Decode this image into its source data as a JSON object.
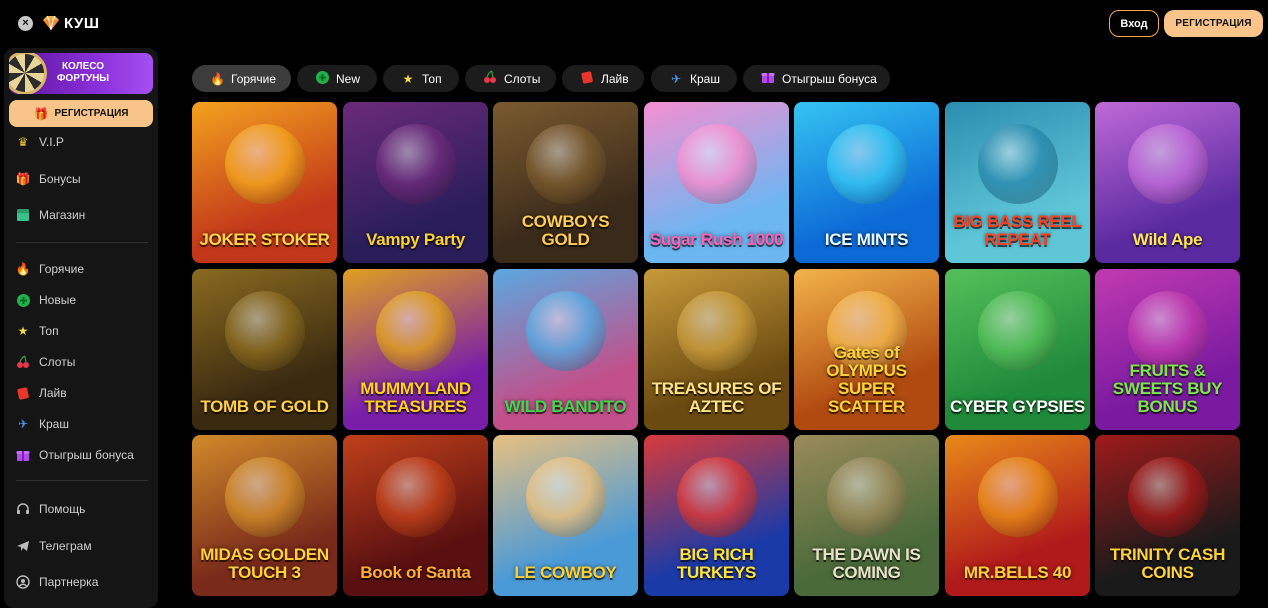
{
  "topbar": {
    "close_symbol": "×",
    "logo_text": "КУШ",
    "login_label": "Вход",
    "register_label": "РЕГИСТРАЦИЯ"
  },
  "sidebar": {
    "wheel_label": "КОЛЕСО ФОРТУНЫ",
    "register_label": "РЕГИСТРАЦИЯ",
    "group1": [
      {
        "label": "V.I.P",
        "icon": "crown-icon"
      },
      {
        "label": "Бонусы",
        "icon": "gift-icon"
      },
      {
        "label": "Магазин",
        "icon": "shop-icon"
      }
    ],
    "group2": [
      {
        "label": "Горячие",
        "icon": "flame-icon"
      },
      {
        "label": "Новые",
        "icon": "plus-icon"
      },
      {
        "label": "Топ",
        "icon": "star-icon"
      },
      {
        "label": "Слоты",
        "icon": "cherry-icon"
      },
      {
        "label": "Лайв",
        "icon": "live-icon"
      },
      {
        "label": "Краш",
        "icon": "plane-icon"
      },
      {
        "label": "Отыгрыш бонуса",
        "icon": "gift-icon"
      }
    ],
    "group3": [
      {
        "label": "Помощь",
        "icon": "headset-icon"
      },
      {
        "label": "Телеграм",
        "icon": "telegram-icon"
      },
      {
        "label": "Партнерка",
        "icon": "partner-icon"
      }
    ]
  },
  "chips": [
    {
      "label": "Горячие",
      "icon": "flame-icon",
      "active": true
    },
    {
      "label": "New",
      "icon": "plus-icon"
    },
    {
      "label": "Топ",
      "icon": "star-icon"
    },
    {
      "label": "Слоты",
      "icon": "cherry-icon"
    },
    {
      "label": "Лайв",
      "icon": "live-icon"
    },
    {
      "label": "Краш",
      "icon": "plane-icon"
    },
    {
      "label": "Отыгрыш бонуса",
      "icon": "gift-icon"
    }
  ],
  "games": [
    {
      "title": "JOKER STOKER",
      "bg": "#c2371a",
      "bg2": "#f3a21f",
      "text": "#ffd44a"
    },
    {
      "title": "Vampy Party",
      "bg": "#2a1e5a",
      "bg2": "#6b2a7a",
      "text": "#ffd233"
    },
    {
      "title": "COWBOYS GOLD",
      "bg": "#3a2a1a",
      "bg2": "#7a5a2e",
      "text": "#ffcc55"
    },
    {
      "title": "Sugar Rush 1000",
      "bg": "#6cb6f2",
      "bg2": "#f58fd0",
      "text": "#ff5fb2"
    },
    {
      "title": "ICE MINTS",
      "bg": "#0c6ad6",
      "bg2": "#35c4f2",
      "text": "#e9fbff"
    },
    {
      "title": "BIG BASS REEL REPEAT",
      "bg": "#5fc6d8",
      "bg2": "#2b8db0",
      "text": "#ff3f1f"
    },
    {
      "title": "Wild Ape",
      "bg": "#5a2aa0",
      "bg2": "#c06ad8",
      "text": "#ffe35a"
    },
    {
      "title": "TOMB OF GOLD",
      "bg": "#3a2a10",
      "bg2": "#8a6a20",
      "text": "#ffce4a"
    },
    {
      "title": "MUMMYLAND TREASURES",
      "bg": "#7a1ea8",
      "bg2": "#e0a020",
      "text": "#ffd11a"
    },
    {
      "title": "WILD BANDITO",
      "bg": "#c2508a",
      "bg2": "#5aa8e0",
      "text": "#3fd84a"
    },
    {
      "title": "TREASURES OF AZTEC",
      "bg": "#6a4a10",
      "bg2": "#c89a3a",
      "text": "#ffe28a"
    },
    {
      "title": "Gates of OLYMPUS SUPER SCATTER",
      "bg": "#b04a10",
      "bg2": "#f3b44a",
      "text": "#ffd23a"
    },
    {
      "title": "CYBER GYPSIES",
      "bg": "#1f8a3a",
      "bg2": "#55c05a",
      "text": "#ffffff"
    },
    {
      "title": "FRUITS & SWEETS BUY BONUS",
      "bg": "#7a1aa0",
      "bg2": "#c03ab0",
      "text": "#7ae84a"
    },
    {
      "title": "MIDAS GOLDEN TOUCH 3",
      "bg": "#7a2a1a",
      "bg2": "#d08a2a",
      "text": "#ffd03a"
    },
    {
      "title": "Book of Santa",
      "bg": "#5a1010",
      "bg2": "#c0401a",
      "text": "#ffb030"
    },
    {
      "title": "LE COWBOY",
      "bg": "#4a9ad8",
      "bg2": "#e8c080",
      "text": "#ffcf2e"
    },
    {
      "title": "BIG RICH TURKEYS",
      "bg": "#1a3aa8",
      "bg2": "#d83a3a",
      "text": "#ffe23a"
    },
    {
      "title": "THE DAWN IS COMING",
      "bg": "#4a6a3a",
      "bg2": "#9a8a5a",
      "text": "#e8e2c8"
    },
    {
      "title": "MR.BELLS 40",
      "bg": "#b01a1a",
      "bg2": "#e88a1a",
      "text": "#ffd03a"
    },
    {
      "title": "TRINITY CASH COINS",
      "bg": "#1a1a1a",
      "bg2": "#a01a1a",
      "text": "#ffd23a"
    }
  ],
  "colors": {
    "accent": "#f9c48a",
    "accent_border": "#f5a94a",
    "sidebar_bg": "#151515",
    "chip_bg": "#1c1c1c",
    "chip_active_bg": "#3c3c3c"
  }
}
